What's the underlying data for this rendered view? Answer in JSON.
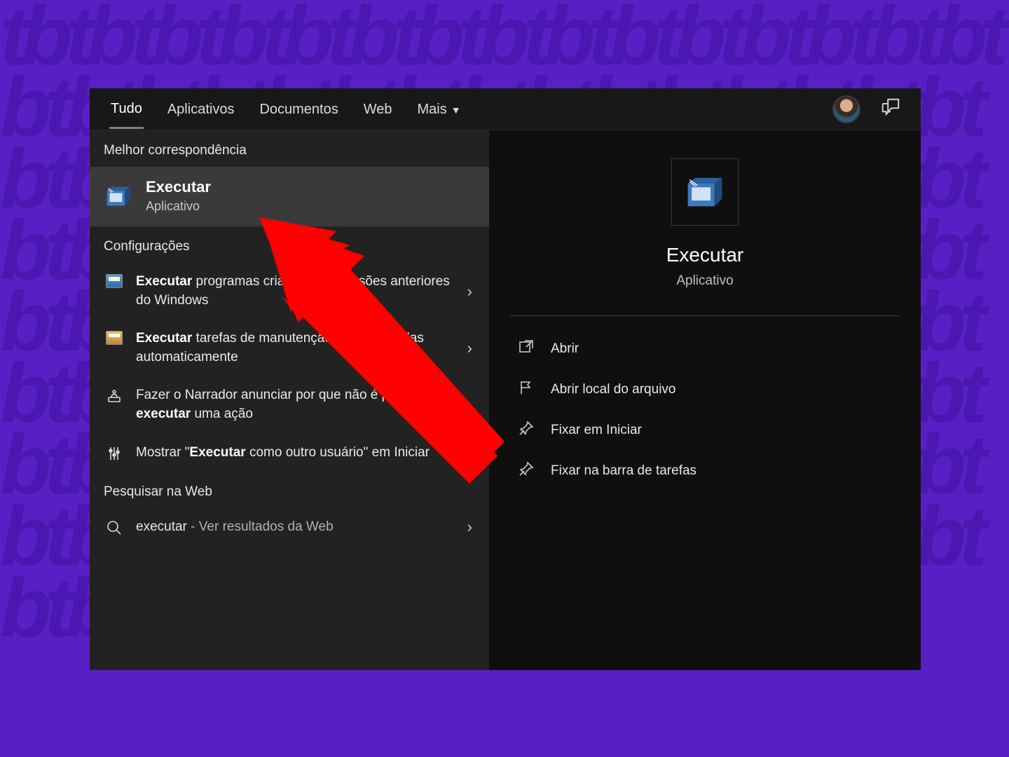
{
  "background_pattern": "tbtbtbtbtbtbtbtbtbtbtbtbtbtbtbtbtbtbtbtbtbtbtbtbtbtbtbtbtbtbtbtbtbtbtbtbtbtbtbtbtbtbtbtbtbtbtbtbtbtbtbtbtbtbtbtbtbtbtbtbtbtbtbtbtbtbtbtbtbtbtbtbtbtbtbtbtbtbtbtbtbtbtbtbtbtbtbtbtbtbtbtbtbtbtbtbtbtbtbtbtbtbtbtbtbtbtbtbtbtbtbtbtbtbtbtbtbtbtbtbtbtbtbtbtbtbtbtbtbtbtb",
  "tabs": {
    "items": [
      "Tudo",
      "Aplicativos",
      "Documentos",
      "Web",
      "Mais"
    ],
    "active_index": 0,
    "more_has_dropdown": true
  },
  "left": {
    "best_match_header": "Melhor correspondência",
    "best_match": {
      "title": "Executar",
      "subtitle": "Aplicativo"
    },
    "settings_header": "Configurações",
    "settings": [
      {
        "html": "<b>Executar</b> programas criados para versões anteriores do Windows",
        "icon": "control-panel-icon"
      },
      {
        "html": "<b>Executar</b> tarefas de manutenção recomendadas automaticamente",
        "icon": "maintenance-icon"
      },
      {
        "html": "Fazer o Narrador anunciar por que não é possível <b>executar</b> uma ação",
        "icon": "narrator-icon"
      },
      {
        "html": "Mostrar \"<b>Executar</b> como outro usuário\" em Iniciar",
        "icon": "user-switch-icon"
      }
    ],
    "web_header": "Pesquisar na Web",
    "web_item": {
      "term": "executar",
      "suffix": "Ver resultados da Web"
    }
  },
  "right": {
    "title": "Executar",
    "subtitle": "Aplicativo",
    "actions": [
      {
        "label": "Abrir",
        "icon": "open-icon"
      },
      {
        "label": "Abrir local do arquivo",
        "icon": "folder-location-icon"
      },
      {
        "label": "Fixar em Iniciar",
        "icon": "pin-icon"
      },
      {
        "label": "Fixar na barra de tarefas",
        "icon": "pin-icon"
      }
    ]
  }
}
